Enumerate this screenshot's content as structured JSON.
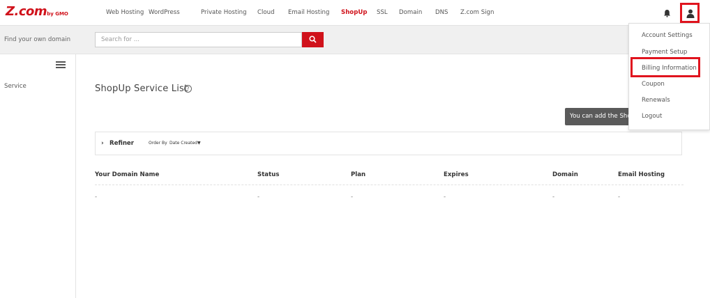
{
  "brand": {
    "name": "Z.com",
    "suffix": "by GMO",
    "color": "#d0121b"
  },
  "nav": {
    "items": [
      {
        "label": "Web Hosting",
        "active": false
      },
      {
        "label": "WordPress",
        "active": false
      },
      {
        "label": "Private Hosting",
        "active": false
      },
      {
        "label": "Cloud",
        "active": false
      },
      {
        "label": "Email Hosting",
        "active": false
      },
      {
        "label": "ShopUp",
        "active": true
      },
      {
        "label": "SSL",
        "active": false
      },
      {
        "label": "Domain",
        "active": false
      },
      {
        "label": "DNS",
        "active": false
      },
      {
        "label": "Z.com Sign",
        "active": false
      }
    ],
    "bell_icon": "bell-icon",
    "user_icon": "user-icon"
  },
  "search": {
    "label": "Find your own domain",
    "placeholder": "Search for ...",
    "value": "",
    "button_icon": "search-icon"
  },
  "sidebar": {
    "menu_icon": "hamburger-icon",
    "items": [
      {
        "label": "Service"
      }
    ]
  },
  "main": {
    "title": "ShopUp Service List",
    "help_symbol": "?",
    "add_notice": "You can add the ShopUp",
    "refiner": {
      "label": "Refiner",
      "order_by_label": "Order By",
      "order_by_value": "Date Created▼"
    },
    "table": {
      "columns": [
        "Your Domain Name",
        "Status",
        "Plan",
        "Expires",
        "Domain",
        "Email Hosting"
      ],
      "rows": [
        [
          "-",
          "-",
          "-",
          "-",
          "-",
          "-"
        ]
      ]
    }
  },
  "account_menu": {
    "items": [
      {
        "label": "Account Settings"
      },
      {
        "label": "Payment Setup"
      },
      {
        "label": "Billing Information",
        "highlighted": true
      },
      {
        "label": "Coupon"
      },
      {
        "label": "Renewals"
      },
      {
        "label": "Logout"
      }
    ],
    "highlight_color": "#e0141e"
  }
}
